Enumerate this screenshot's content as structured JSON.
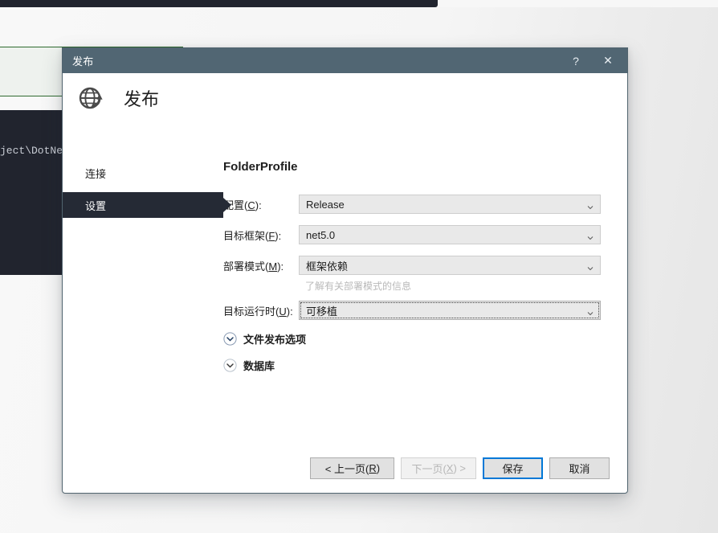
{
  "background": {
    "code_text": "ject\\DotNetPr",
    "colors": {
      "dark_panel": "#21242e",
      "green_border": "#2f6b30",
      "sheet": "#f5f5f5"
    }
  },
  "dialog": {
    "titlebar": {
      "title": "发布",
      "help_icon": "question-mark-icon",
      "help_label": "?",
      "close_icon": "close-icon",
      "close_label": "✕",
      "color": "#516673"
    },
    "header": {
      "icon": "publish-globe-icon",
      "heading": "发布"
    },
    "sidebar": {
      "items": [
        {
          "label": "连接",
          "selected": false
        },
        {
          "label": "设置",
          "selected": true
        }
      ],
      "selected_color": "#252a35"
    },
    "content": {
      "profile_title": "FolderProfile",
      "fields": [
        {
          "label_prefix": "配置(",
          "accel": "C",
          "label_suffix": "):",
          "value": "Release",
          "focused": false,
          "hint": ""
        },
        {
          "label_prefix": "目标框架(",
          "accel": "F",
          "label_suffix": "):",
          "value": "net5.0",
          "focused": false,
          "hint": ""
        },
        {
          "label_prefix": "部署模式(",
          "accel": "M",
          "label_suffix": "):",
          "value": "框架依赖",
          "focused": false,
          "hint": "了解有关部署模式的信息"
        },
        {
          "label_prefix": "目标运行时(",
          "accel": "U",
          "label_suffix": "):",
          "value": "可移植",
          "focused": true,
          "hint": ""
        }
      ],
      "expanders": [
        {
          "label": "文件发布选项",
          "icon": "chevron-down-circle-icon",
          "expanded": false
        },
        {
          "label": "数据库",
          "icon": "chevron-down-circle-icon",
          "expanded": false
        }
      ]
    },
    "footer": {
      "buttons": [
        {
          "prefix": "< 上一页(",
          "accel": "R",
          "suffix": ")",
          "state": "normal",
          "wide": true
        },
        {
          "prefix": "下一页(",
          "accel": "X",
          "suffix": ") >",
          "state": "disabled",
          "wide": false
        },
        {
          "prefix": "保存",
          "accel": "",
          "suffix": "",
          "state": "default",
          "wide": false
        },
        {
          "prefix": "取消",
          "accel": "",
          "suffix": "",
          "state": "normal",
          "wide": false
        }
      ],
      "accent_color": "#0078d7"
    }
  }
}
